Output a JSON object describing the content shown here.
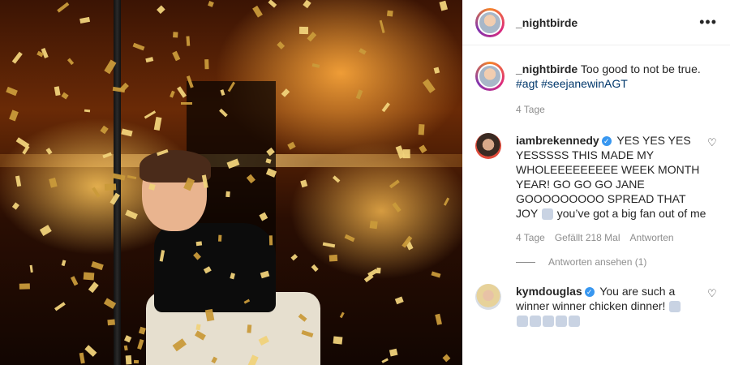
{
  "post": {
    "username": "_nightbirde",
    "caption_username": "_nightbirde",
    "caption_text": "Too good to not be true.",
    "hashtags": [
      "#agt",
      "#seejanewinAGT"
    ],
    "caption_age": "4 Tage",
    "more_icon": "more-horizontal-icon"
  },
  "comments": [
    {
      "username": "iambrekennedy",
      "verified": true,
      "text": "YES YES YES YESSSSS THIS MADE MY WHOLEEEEEEEEE WEEK MONTH YEAR! GO GO GO JANE GOOOOOOOOO SPREAD THAT JOY",
      "text_after_emoji": "you’ve got a big fan out of me",
      "age": "4 Tage",
      "likes": "Gefällt 218 Mal",
      "reply": "Antworten",
      "view_replies": "Antworten ansehen (1)"
    },
    {
      "username": "kymdouglas",
      "verified": true,
      "text": "You are such a winner winner chicken dinner!"
    }
  ],
  "colors": {
    "accent_link": "#00376b",
    "verified": "#3897f0",
    "muted": "#8e8e8e"
  }
}
